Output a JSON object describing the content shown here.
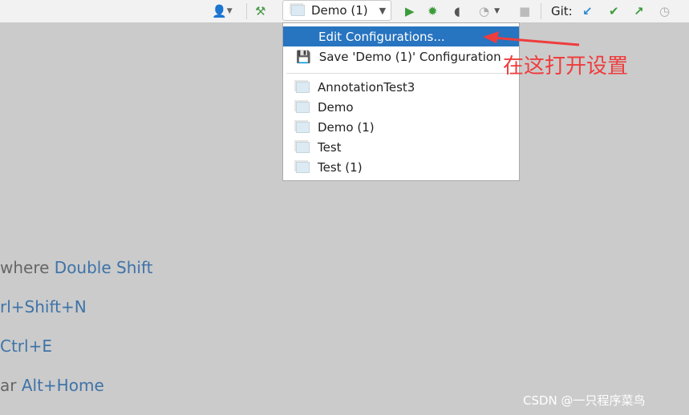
{
  "toolbar": {
    "run_config": "Demo (1)",
    "git_label": "Git:"
  },
  "menu": {
    "edit": "Edit Configurations...",
    "save": "Save 'Demo (1)' Configuration",
    "items": [
      "AnnotationTest3",
      "Demo",
      "Demo (1)",
      "Test",
      "Test (1)"
    ]
  },
  "hints": [
    {
      "pre": "where ",
      "key": "Double Shift"
    },
    {
      "pre": "",
      "key": "rl+Shift+N"
    },
    {
      "pre": "",
      "key": "Ctrl+E"
    },
    {
      "pre": "ar ",
      "key": "Alt+Home"
    }
  ],
  "annotation": "在这打开设置",
  "watermark": "CSDN @一只程序菜鸟",
  "colors": {
    "accent": "#2774c0",
    "annotation": "#ee3d3d"
  }
}
